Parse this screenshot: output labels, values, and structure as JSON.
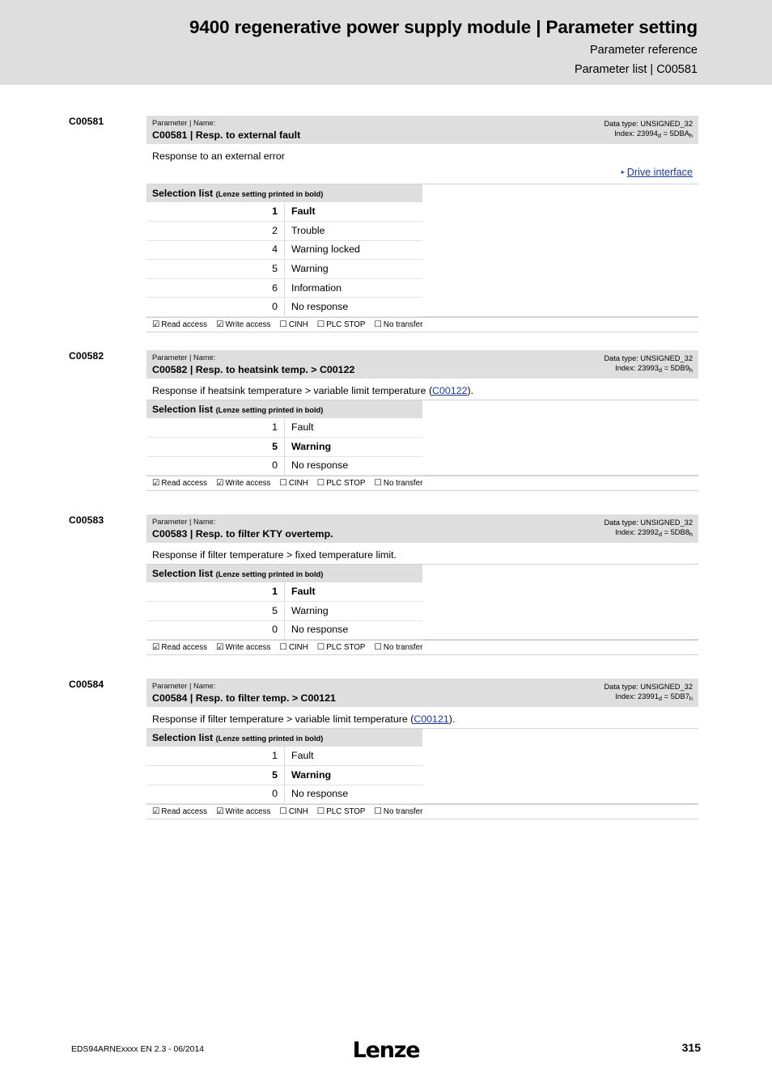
{
  "header": {
    "title": "9400 regenerative power supply module | Parameter setting",
    "subtitle1": "Parameter reference",
    "subtitle2": "Parameter list | C00581"
  },
  "labels": {
    "parameter_name_caption": "Parameter | Name:",
    "selection_list_title": "Selection list",
    "selection_list_note": "(Lenze setting printed in bold)",
    "data_type_prefix": "Data type: ",
    "index_prefix": "Index: "
  },
  "flags": {
    "read_access": {
      "label": "Read access",
      "checked": true,
      "glyph": "☑"
    },
    "write_access": {
      "label": "Write access",
      "checked": true,
      "glyph": "☑"
    },
    "cinh": {
      "label": "CINH",
      "checked": false,
      "glyph": "☐"
    },
    "plc_stop": {
      "label": "PLC STOP",
      "checked": false,
      "glyph": "☐"
    },
    "no_transfer": {
      "label": "No transfer",
      "checked": false,
      "glyph": "☐"
    }
  },
  "colors": {
    "header_band": "#dedede",
    "table_head": "#dedede",
    "link": "#1b3a8c",
    "rule": "#d2d2d2"
  },
  "blocks": [
    {
      "code": "C00581",
      "name": "C00581 | Resp. to external fault",
      "data_type": "UNSIGNED_32",
      "index_dec": "23994",
      "index_hex": "5DBA",
      "description": "Response to an external error",
      "description_link": null,
      "description_suffix": null,
      "xref": {
        "label": "Drive interface",
        "arrow": "▸"
      },
      "options": [
        {
          "value": "1",
          "text": "Fault",
          "bold": true
        },
        {
          "value": "2",
          "text": "Trouble",
          "bold": false
        },
        {
          "value": "4",
          "text": "Warning locked",
          "bold": false
        },
        {
          "value": "5",
          "text": "Warning",
          "bold": false
        },
        {
          "value": "6",
          "text": "Information",
          "bold": false
        },
        {
          "value": "0",
          "text": "No response",
          "bold": false
        }
      ]
    },
    {
      "code": "C00582",
      "name": "C00582 | Resp. to heatsink temp. > C00122",
      "data_type": "UNSIGNED_32",
      "index_dec": "23993",
      "index_hex": "5DB9",
      "description": "Response if heatsink temperature > variable limit temperature (",
      "description_link": "C00122",
      "description_suffix": ").",
      "xref": null,
      "options": [
        {
          "value": "1",
          "text": "Fault",
          "bold": false
        },
        {
          "value": "5",
          "text": "Warning",
          "bold": true
        },
        {
          "value": "0",
          "text": "No response",
          "bold": false
        }
      ]
    },
    {
      "code": "C00583",
      "name": "C00583 | Resp. to filter KTY overtemp.",
      "data_type": "UNSIGNED_32",
      "index_dec": "23992",
      "index_hex": "5DB8",
      "description": "Response if filter temperature > fixed temperature limit.",
      "description_link": null,
      "description_suffix": null,
      "xref": null,
      "options": [
        {
          "value": "1",
          "text": "Fault",
          "bold": true
        },
        {
          "value": "5",
          "text": "Warning",
          "bold": false
        },
        {
          "value": "0",
          "text": "No response",
          "bold": false
        }
      ]
    },
    {
      "code": "C00584",
      "name": "C00584 | Resp. to filter temp. > C00121",
      "data_type": "UNSIGNED_32",
      "index_dec": "23991",
      "index_hex": "5DB7",
      "description": "Response if filter temperature > variable limit temperature (",
      "description_link": "C00121",
      "description_suffix": ").",
      "xref": null,
      "options": [
        {
          "value": "1",
          "text": "Fault",
          "bold": false
        },
        {
          "value": "5",
          "text": "Warning",
          "bold": true
        },
        {
          "value": "0",
          "text": "No response",
          "bold": false
        }
      ]
    }
  ],
  "footer": {
    "document_id": "EDS94ARNExxxx EN 2.3 - 06/2014",
    "brand": "Lenze",
    "page_number": "315"
  }
}
